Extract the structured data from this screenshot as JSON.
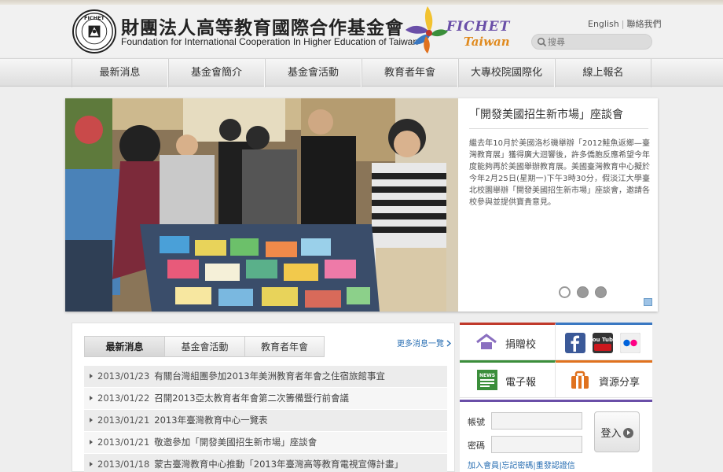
{
  "header": {
    "org_name_cn": "財團法人高等教育國際合作基金會",
    "org_name_en": "Foundation for International Cooperation In Higher Education of Taiwan",
    "seal_text": "FICHET",
    "brand_line1": "FICHET",
    "brand_line2": "Taiwan",
    "links": {
      "english": "English",
      "separator": "|",
      "contact": "聯絡我們"
    },
    "search": {
      "placeholder": "搜尋"
    }
  },
  "nav": {
    "items": [
      {
        "label": "最新消息"
      },
      {
        "label": "基金會簡介"
      },
      {
        "label": "基金會活動"
      },
      {
        "label": "教育者年會"
      },
      {
        "label": "大專校院國際化"
      },
      {
        "label": "線上報名"
      }
    ]
  },
  "banner": {
    "title": "「開發美國招生新市場」座談會",
    "body": "繼去年10月於美國洛杉磯舉辦「2012鮭魚返鄉—臺灣教育展」獲得廣大迴響後，許多僑胞反應希望今年度能夠再於美國舉辦教育展。美國臺灣教育中心擬於今年2月25日(星期一)下午3時30分，假淡江大學臺北校園舉辦「開發美國招生新市場」座談會，邀請各校參與並提供寶貴意見。",
    "slide_count": 3,
    "active_slide": 1
  },
  "news": {
    "tabs": [
      {
        "label": "最新消息",
        "active": true
      },
      {
        "label": "基金會活動",
        "active": false
      },
      {
        "label": "教育者年會",
        "active": false
      }
    ],
    "more_label": "更多消息一覽",
    "items": [
      {
        "date": "2013/01/23",
        "title": "有關台灣組團參加2013年美洲教育者年會之住宿旅館事宜"
      },
      {
        "date": "2013/01/22",
        "title": "召開2013亞太教育者年會第二次籌備暨行前會議"
      },
      {
        "date": "2013/01/21",
        "title": "2013年臺灣教育中心一覽表"
      },
      {
        "date": "2013/01/21",
        "title": "敬邀參加「開發美國招生新市場」座談會"
      },
      {
        "date": "2013/01/18",
        "title": "蒙古臺灣教育中心推動「2013年臺灣高等教育電視宣傳計畫」"
      }
    ]
  },
  "sidebar": {
    "donate_label": "捐贈校",
    "epaper_label": "電子報",
    "epaper_badge": "NEWS",
    "resources_label": "資源分享",
    "youtube_label": "You Tube",
    "login": {
      "account_label": "帳號",
      "password_label": "密碼",
      "button_label": "登入",
      "links": "加入會員|忘記密碼|重發認證信"
    }
  },
  "colors": {
    "donate_accent": "#c0392b",
    "social_accent": "#3a78c2",
    "epaper_accent": "#3b8e3b",
    "resources_accent": "#e0721f",
    "login_accent": "#6a4fa8",
    "link": "#2a6fb3"
  },
  "icons": {
    "seal": "foundation-seal",
    "brand": "bird-logo",
    "search": "search-icon",
    "donate": "house-icon",
    "facebook": "facebook-icon",
    "youtube": "youtube-icon",
    "flickr": "flickr-icon",
    "epaper": "news-icon",
    "resources": "briefcase-icon"
  }
}
